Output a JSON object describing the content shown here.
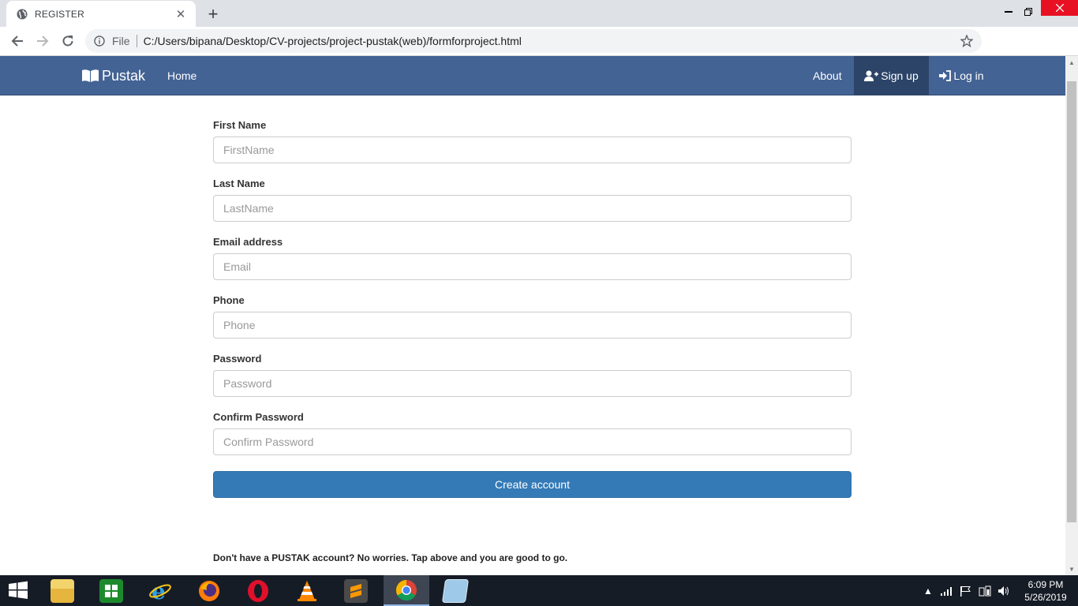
{
  "browser": {
    "tab_title": "REGISTER",
    "address_scheme": "File",
    "address_url": "C:/Users/bipana/Desktop/CV-projects/project-pustak(web)/formforproject.html"
  },
  "navbar": {
    "brand": "Pustak",
    "home": "Home",
    "about": "About",
    "signup": "Sign up",
    "login": "Log in",
    "bg_color": "#436394",
    "active_bg": "#2b4468"
  },
  "form": {
    "fields": [
      {
        "label": "First Name",
        "placeholder": "FirstName"
      },
      {
        "label": "Last Name",
        "placeholder": "LastName"
      },
      {
        "label": "Email address",
        "placeholder": "Email"
      },
      {
        "label": "Phone",
        "placeholder": "Phone"
      },
      {
        "label": "Password",
        "placeholder": "Password"
      },
      {
        "label": "Confirm Password",
        "placeholder": "Confirm Password"
      }
    ],
    "submit": "Create account",
    "submit_color": "#337ab7"
  },
  "footer_note": "Don't have a PUSTAK account? No worries. Tap above and you are good to go.",
  "taskbar": {
    "apps": [
      "file-explorer-icon",
      "store-icon",
      "internet-explorer-icon",
      "firefox-icon",
      "opera-icon",
      "vlc-icon",
      "sublime-text-icon",
      "chrome-icon",
      "notepad-icon"
    ],
    "time": "6:09 PM",
    "date": "5/26/2019"
  }
}
